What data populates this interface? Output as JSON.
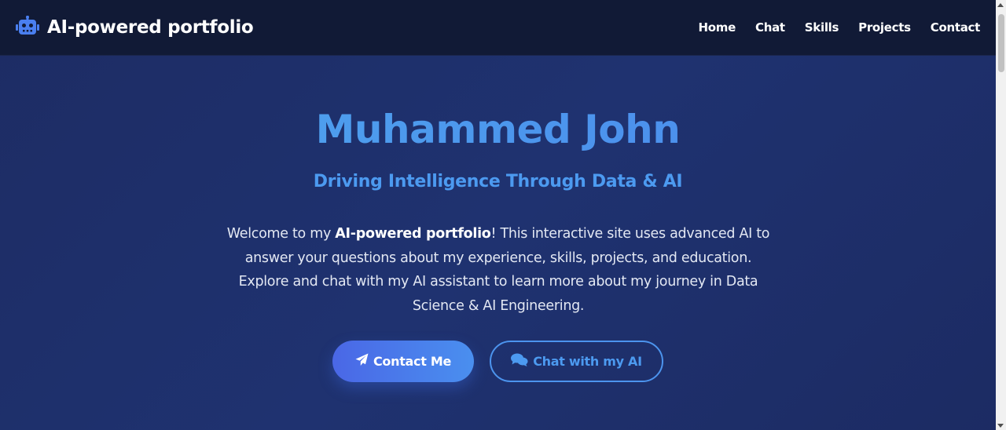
{
  "nav": {
    "brand_icon": "robot-icon",
    "brand_text": "AI-powered portfolio",
    "links": [
      {
        "label": "Home"
      },
      {
        "label": "Chat"
      },
      {
        "label": "Skills"
      },
      {
        "label": "Projects"
      },
      {
        "label": "Contact"
      }
    ]
  },
  "hero": {
    "name": "Muhammed John",
    "tagline": "Driving Intelligence Through Data & AI",
    "description": {
      "prefix": "Welcome to my ",
      "bold": "AI-powered portfolio",
      "suffix": "! This interactive site uses advanced AI to answer your questions about my experience, skills, projects, and education. Explore and chat with my AI assistant to learn more about my journey in Data Science & AI Engineering."
    },
    "buttons": {
      "contact_label": "Contact Me",
      "contact_icon": "paper-plane-icon",
      "chat_label": "Chat with my AI",
      "chat_icon": "chat-bubbles-icon"
    }
  },
  "colors": {
    "navbar_bg": "#111a36",
    "hero_bg": "#1f3270",
    "accent": "#4c9af0",
    "button_gradient_start": "#4a67e6",
    "button_gradient_end": "#4a8fef"
  }
}
